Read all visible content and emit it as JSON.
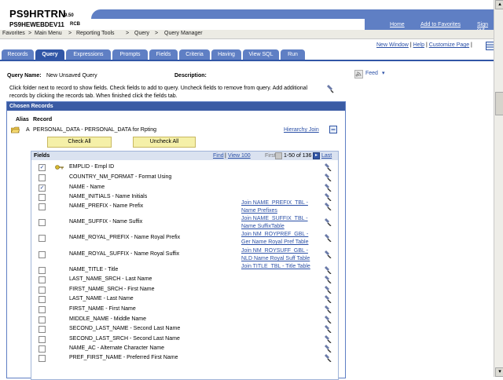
{
  "header": {
    "system": "PS9HRTRN",
    "version": "9.50",
    "database": "PS9HEWEBDEV11",
    "user": "RCB",
    "links": [
      "Home",
      "Add to Favorites",
      "Sign out"
    ]
  },
  "menubar": {
    "items": [
      "Favorites",
      "Main Menu",
      "Reporting Tools",
      "Query",
      "Query Manager"
    ],
    "separator": ">"
  },
  "toplinks": {
    "new_window": "New Window",
    "sep": "|",
    "help": "Help",
    "customize": "Customize Page"
  },
  "tabs": [
    "Records",
    "Query",
    "Expressions",
    "Prompts",
    "Fields",
    "Criteria",
    "Having",
    "View SQL",
    "Run"
  ],
  "query": {
    "name_label": "Query Name:",
    "name_value": "New Unsaved Query",
    "desc_label": "Description:",
    "feed_label": "Feed",
    "hint": "Click folder next to record to show fields. Check fields to add to query. Uncheck fields to remove from query. Add additional records by clicking the records tab. When finished click the fields tab."
  },
  "chosen": {
    "title": "Chosen Records",
    "col_alias": "Alias",
    "col_record": "Record",
    "alias": "A",
    "record": "PERSONAL_DATA - PERSONAL_DATA for Rpting",
    "hierarchy_join": "Hierarchy Join",
    "check_all": "Check All",
    "uncheck_all": "Uncheck All"
  },
  "fields": {
    "title": "Fields",
    "find": "Find",
    "view": "View 100",
    "first": "First",
    "range": "1-50 of 136",
    "last": "Last",
    "rows": [
      {
        "name": "EMPLID - Empl ID",
        "checked": true,
        "key": true,
        "join": []
      },
      {
        "name": "COUNTRY_NM_FORMAT - Format Using",
        "checked": false,
        "key": false,
        "join": []
      },
      {
        "name": "NAME - Name",
        "checked": true,
        "key": false,
        "join": []
      },
      {
        "name": "NAME_INITIALS - Name Initials",
        "checked": false,
        "key": false,
        "join": []
      },
      {
        "name": "NAME_PREFIX - Name Prefix",
        "checked": false,
        "key": false,
        "join": [
          "Join NAME_PREFIX_TBL -",
          "Name Prefixes"
        ]
      },
      {
        "name": "NAME_SUFFIX - Name Suffix",
        "checked": false,
        "key": false,
        "join": [
          "Join NAME_SUFFIX_TBL -",
          "Name SuffixTable"
        ]
      },
      {
        "name": "NAME_ROYAL_PREFIX - Name Royal Prefix",
        "checked": false,
        "key": false,
        "join": [
          "Join NM_ROYPREF_GBL -",
          "Ger Name Royal Pref Table"
        ]
      },
      {
        "name": "NAME_ROYAL_SUFFIX - Name Royal Suffix",
        "checked": false,
        "key": false,
        "join": [
          "Join NM_ROYSUFF_GBL -",
          "NLD Name Royal Suff Table"
        ]
      },
      {
        "name": "NAME_TITLE - Title",
        "checked": false,
        "key": false,
        "join": [
          "Join TITLE_TBL - Title Table"
        ]
      },
      {
        "name": "LAST_NAME_SRCH - Last Name",
        "checked": false,
        "key": false,
        "join": []
      },
      {
        "name": "FIRST_NAME_SRCH - First Name",
        "checked": false,
        "key": false,
        "join": []
      },
      {
        "name": "LAST_NAME - Last Name",
        "checked": false,
        "key": false,
        "join": []
      },
      {
        "name": "FIRST_NAME - First Name",
        "checked": false,
        "key": false,
        "join": []
      },
      {
        "name": "MIDDLE_NAME - Middle Name",
        "checked": false,
        "key": false,
        "join": []
      },
      {
        "name": "SECOND_LAST_NAME - Second Last Name",
        "checked": false,
        "key": false,
        "join": []
      },
      {
        "name": "SECOND_LAST_SRCH - Second Last Name",
        "checked": false,
        "key": false,
        "join": []
      },
      {
        "name": "NAME_AC - Alternate Character Name",
        "checked": false,
        "key": false,
        "join": []
      },
      {
        "name": "PREF_FIRST_NAME - Preferred First Name",
        "checked": false,
        "key": false,
        "join": []
      }
    ]
  },
  "colors": {
    "tab": "#5f7fc4",
    "tab_active": "#3156a6",
    "panel_header": "#3a5ba4",
    "link": "#2a4fa6",
    "button": "#f5f0a8"
  }
}
